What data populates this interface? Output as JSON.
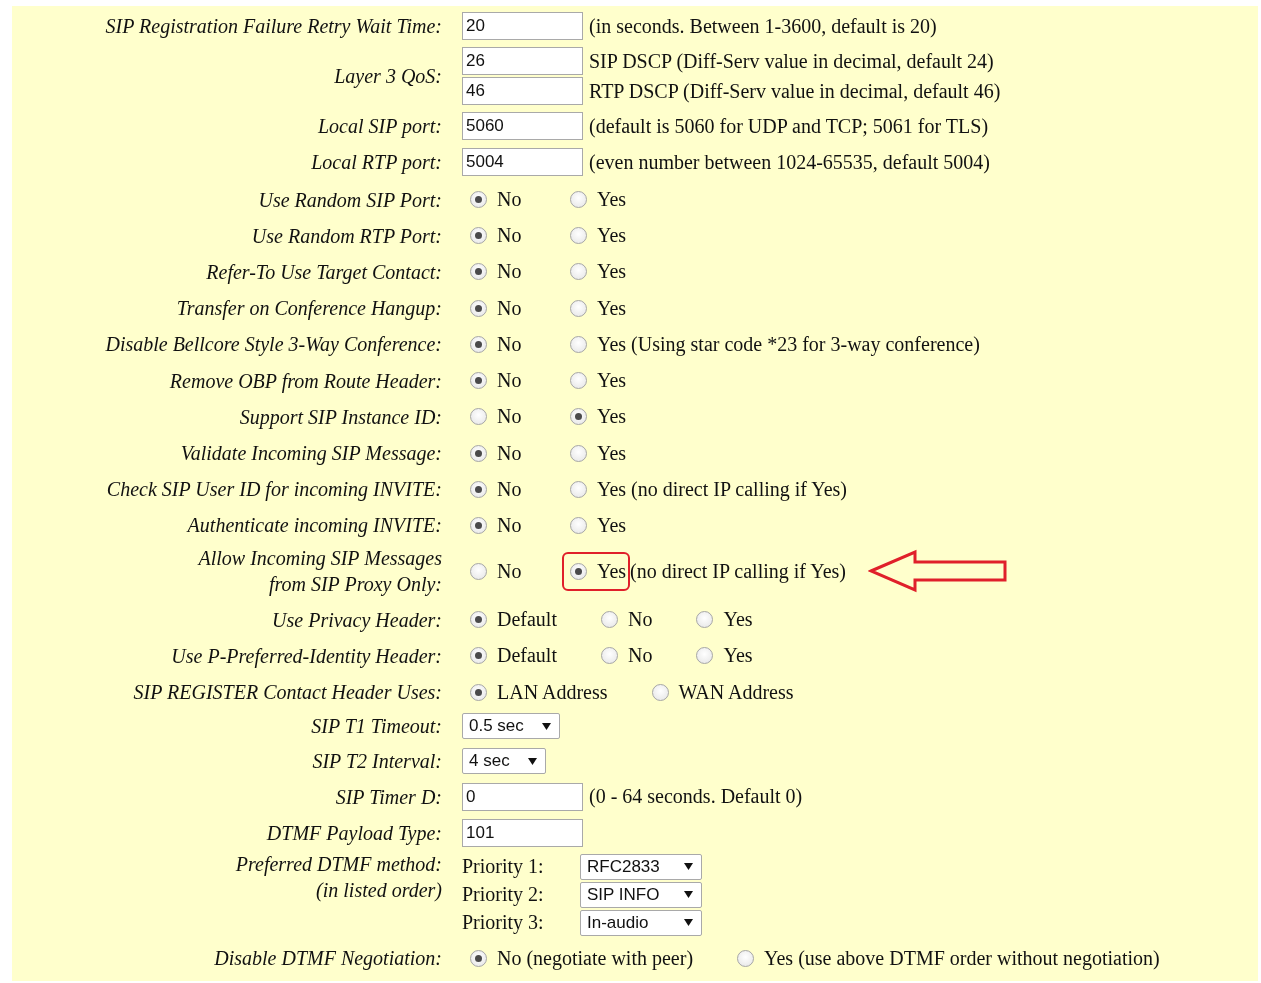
{
  "settings": [
    {
      "label": "SIP Registration Failure Retry Wait Time:",
      "kind": "text",
      "fields": [
        {
          "value": "20",
          "note": "(in seconds. Between 1-3600, default is 20)"
        }
      ]
    },
    {
      "label": "Layer 3 QoS:",
      "kind": "text",
      "fields": [
        {
          "value": "26",
          "note": "SIP DSCP (Diff-Serv value in decimal, default 24)"
        },
        {
          "value": "46",
          "note": "RTP DSCP (Diff-Serv value in decimal, default 46)"
        }
      ]
    },
    {
      "label": "Local SIP port:",
      "kind": "text",
      "fields": [
        {
          "value": "5060",
          "note": "(default is 5060 for UDP and TCP; 5061 for TLS)"
        }
      ]
    },
    {
      "label": "Local RTP port:",
      "kind": "text",
      "fields": [
        {
          "value": "5004",
          "note": "(even number between 1024-65535, default 5004)"
        }
      ]
    },
    {
      "label": "Use Random SIP Port:",
      "kind": "radio",
      "options": [
        {
          "label": "No",
          "selected": true
        },
        {
          "label": "Yes",
          "selected": false
        }
      ]
    },
    {
      "label": "Use Random RTP Port:",
      "kind": "radio",
      "options": [
        {
          "label": "No",
          "selected": true
        },
        {
          "label": "Yes",
          "selected": false
        }
      ]
    },
    {
      "label": "Refer-To Use Target Contact:",
      "kind": "radio",
      "options": [
        {
          "label": "No",
          "selected": true
        },
        {
          "label": "Yes",
          "selected": false
        }
      ]
    },
    {
      "label": "Transfer on Conference Hangup:",
      "kind": "radio",
      "options": [
        {
          "label": "No",
          "selected": true
        },
        {
          "label": "Yes",
          "selected": false
        }
      ]
    },
    {
      "label": "Disable Bellcore Style 3-Way Conference:",
      "kind": "radio",
      "options": [
        {
          "label": "No",
          "selected": true
        },
        {
          "label": "Yes (Using star code *23 for 3-way conference)",
          "selected": false
        }
      ]
    },
    {
      "label": "Remove OBP from Route Header:",
      "kind": "radio",
      "options": [
        {
          "label": "No",
          "selected": true
        },
        {
          "label": "Yes",
          "selected": false
        }
      ]
    },
    {
      "label": "Support SIP Instance ID:",
      "kind": "radio",
      "options": [
        {
          "label": "No",
          "selected": false
        },
        {
          "label": "Yes",
          "selected": true
        }
      ]
    },
    {
      "label": "Validate Incoming SIP Message:",
      "kind": "radio",
      "options": [
        {
          "label": "No",
          "selected": true
        },
        {
          "label": "Yes",
          "selected": false
        }
      ]
    },
    {
      "label": "Check SIP User ID for incoming INVITE:",
      "kind": "radio",
      "options": [
        {
          "label": "No",
          "selected": true
        },
        {
          "label": "Yes (no direct IP calling if Yes)",
          "selected": false
        }
      ]
    },
    {
      "label": "Authenticate incoming INVITE:",
      "kind": "radio",
      "options": [
        {
          "label": "No",
          "selected": true
        },
        {
          "label": "Yes",
          "selected": false
        }
      ]
    },
    {
      "label": "Allow Incoming SIP Messages\nfrom SIP Proxy Only:",
      "kind": "radio",
      "arrow": true,
      "options": [
        {
          "label": "No",
          "selected": false
        },
        {
          "label": "Yes",
          "selected": true,
          "highlighted": true,
          "note": "(no direct IP calling if Yes)"
        }
      ]
    },
    {
      "label": "Use Privacy Header:",
      "kind": "radio",
      "options": [
        {
          "label": "Default",
          "selected": true
        },
        {
          "label": "No",
          "selected": false
        },
        {
          "label": "Yes",
          "selected": false
        }
      ]
    },
    {
      "label": "Use P-Preferred-Identity Header:",
      "kind": "radio",
      "options": [
        {
          "label": "Default",
          "selected": true
        },
        {
          "label": "No",
          "selected": false
        },
        {
          "label": "Yes",
          "selected": false
        }
      ]
    },
    {
      "label": "SIP REGISTER Contact Header Uses:",
      "kind": "radio",
      "options": [
        {
          "label": "LAN Address",
          "selected": true
        },
        {
          "label": "WAN Address",
          "selected": false
        }
      ]
    },
    {
      "label": "SIP T1 Timeout:",
      "kind": "select",
      "value": "0.5 sec"
    },
    {
      "label": "SIP T2 Interval:",
      "kind": "select",
      "value": "4 sec"
    },
    {
      "label": "SIP Timer D:",
      "kind": "text",
      "fields": [
        {
          "value": "0",
          "note": "(0 - 64 seconds. Default 0)"
        }
      ]
    },
    {
      "label": "DTMF Payload Type:",
      "kind": "text",
      "fields": [
        {
          "value": "101"
        }
      ]
    },
    {
      "label": "Preferred DTMF method:",
      "sublabel": "(in listed order)",
      "kind": "priority",
      "priorities": [
        {
          "label": "Priority 1:",
          "value": "RFC2833"
        },
        {
          "label": "Priority 2:",
          "value": "SIP INFO"
        },
        {
          "label": "Priority 3:",
          "value": "In-audio"
        }
      ]
    },
    {
      "label": "Disable DTMF Negotiation:",
      "kind": "radio",
      "options": [
        {
          "label": "No (negotiate with peer)",
          "selected": true
        },
        {
          "label": "Yes (use above DTMF order without negotiation)",
          "selected": false
        }
      ]
    }
  ]
}
